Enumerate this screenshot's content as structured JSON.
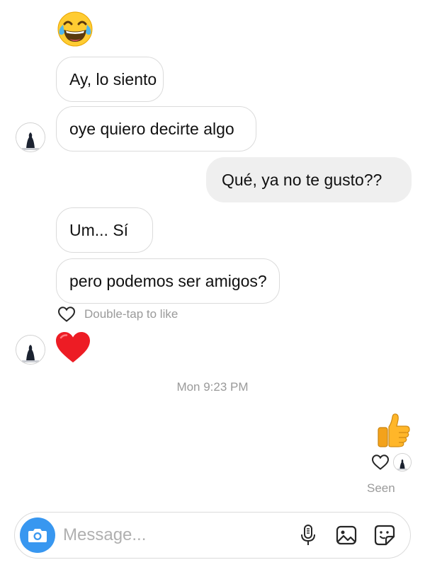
{
  "thread": {
    "messages": [
      {
        "id": "m-laugh",
        "sender": "them",
        "type": "emoji",
        "emoji": "face-with-tears-of-joy-icon"
      },
      {
        "id": "m1",
        "sender": "them",
        "text": "Ay, lo siento"
      },
      {
        "id": "m2",
        "sender": "them",
        "text": "oye quiero decirte algo"
      },
      {
        "id": "m3",
        "sender": "me",
        "text": "Qué, ya no te gusto??"
      },
      {
        "id": "m4",
        "sender": "them",
        "text": "Um... Sí"
      },
      {
        "id": "m5",
        "sender": "them",
        "text": "pero podemos ser amigos?"
      },
      {
        "id": "m-heart",
        "sender": "them",
        "type": "emoji",
        "emoji": "red-heart-icon"
      },
      {
        "id": "m-thumb",
        "sender": "me",
        "type": "emoji",
        "emoji": "thumbs-up-icon"
      }
    ],
    "like_hint": "Double-tap to like",
    "timestamp": "Mon 9:23 PM",
    "seen_label": "Seen"
  },
  "composer": {
    "placeholder": "Message...",
    "icons": [
      "camera-icon",
      "microphone-icon",
      "gallery-icon",
      "sticker-icon"
    ]
  },
  "colors": {
    "camera_button": "#3897f0",
    "my_bubble": "#efefef",
    "their_bubble_border": "#dbdbdb",
    "heart": "#ed1c24",
    "muted_text": "#9a9a9a"
  }
}
